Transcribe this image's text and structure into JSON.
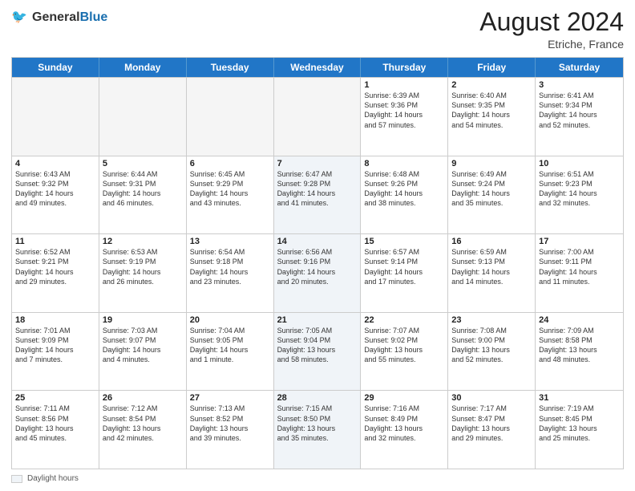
{
  "header": {
    "logo_general": "General",
    "logo_blue": "Blue",
    "month_year": "August 2024",
    "location": "Etriche, France"
  },
  "days_of_week": [
    "Sunday",
    "Monday",
    "Tuesday",
    "Wednesday",
    "Thursday",
    "Friday",
    "Saturday"
  ],
  "legend": {
    "label": "Daylight hours"
  },
  "weeks": [
    {
      "cells": [
        {
          "day": "",
          "content": "",
          "empty": true
        },
        {
          "day": "",
          "content": "",
          "empty": true
        },
        {
          "day": "",
          "content": "",
          "empty": true
        },
        {
          "day": "",
          "content": "",
          "empty": true
        },
        {
          "day": "1",
          "content": "Sunrise: 6:39 AM\nSunset: 9:36 PM\nDaylight: 14 hours\nand 57 minutes.",
          "empty": false
        },
        {
          "day": "2",
          "content": "Sunrise: 6:40 AM\nSunset: 9:35 PM\nDaylight: 14 hours\nand 54 minutes.",
          "empty": false
        },
        {
          "day": "3",
          "content": "Sunrise: 6:41 AM\nSunset: 9:34 PM\nDaylight: 14 hours\nand 52 minutes.",
          "empty": false
        }
      ]
    },
    {
      "cells": [
        {
          "day": "4",
          "content": "Sunrise: 6:43 AM\nSunset: 9:32 PM\nDaylight: 14 hours\nand 49 minutes.",
          "empty": false
        },
        {
          "day": "5",
          "content": "Sunrise: 6:44 AM\nSunset: 9:31 PM\nDaylight: 14 hours\nand 46 minutes.",
          "empty": false
        },
        {
          "day": "6",
          "content": "Sunrise: 6:45 AM\nSunset: 9:29 PM\nDaylight: 14 hours\nand 43 minutes.",
          "empty": false
        },
        {
          "day": "7",
          "content": "Sunrise: 6:47 AM\nSunset: 9:28 PM\nDaylight: 14 hours\nand 41 minutes.",
          "empty": false
        },
        {
          "day": "8",
          "content": "Sunrise: 6:48 AM\nSunset: 9:26 PM\nDaylight: 14 hours\nand 38 minutes.",
          "empty": false
        },
        {
          "day": "9",
          "content": "Sunrise: 6:49 AM\nSunset: 9:24 PM\nDaylight: 14 hours\nand 35 minutes.",
          "empty": false
        },
        {
          "day": "10",
          "content": "Sunrise: 6:51 AM\nSunset: 9:23 PM\nDaylight: 14 hours\nand 32 minutes.",
          "empty": false
        }
      ]
    },
    {
      "cells": [
        {
          "day": "11",
          "content": "Sunrise: 6:52 AM\nSunset: 9:21 PM\nDaylight: 14 hours\nand 29 minutes.",
          "empty": false
        },
        {
          "day": "12",
          "content": "Sunrise: 6:53 AM\nSunset: 9:19 PM\nDaylight: 14 hours\nand 26 minutes.",
          "empty": false
        },
        {
          "day": "13",
          "content": "Sunrise: 6:54 AM\nSunset: 9:18 PM\nDaylight: 14 hours\nand 23 minutes.",
          "empty": false
        },
        {
          "day": "14",
          "content": "Sunrise: 6:56 AM\nSunset: 9:16 PM\nDaylight: 14 hours\nand 20 minutes.",
          "empty": false
        },
        {
          "day": "15",
          "content": "Sunrise: 6:57 AM\nSunset: 9:14 PM\nDaylight: 14 hours\nand 17 minutes.",
          "empty": false
        },
        {
          "day": "16",
          "content": "Sunrise: 6:59 AM\nSunset: 9:13 PM\nDaylight: 14 hours\nand 14 minutes.",
          "empty": false
        },
        {
          "day": "17",
          "content": "Sunrise: 7:00 AM\nSunset: 9:11 PM\nDaylight: 14 hours\nand 11 minutes.",
          "empty": false
        }
      ]
    },
    {
      "cells": [
        {
          "day": "18",
          "content": "Sunrise: 7:01 AM\nSunset: 9:09 PM\nDaylight: 14 hours\nand 7 minutes.",
          "empty": false
        },
        {
          "day": "19",
          "content": "Sunrise: 7:03 AM\nSunset: 9:07 PM\nDaylight: 14 hours\nand 4 minutes.",
          "empty": false
        },
        {
          "day": "20",
          "content": "Sunrise: 7:04 AM\nSunset: 9:05 PM\nDaylight: 14 hours\nand 1 minute.",
          "empty": false
        },
        {
          "day": "21",
          "content": "Sunrise: 7:05 AM\nSunset: 9:04 PM\nDaylight: 13 hours\nand 58 minutes.",
          "empty": false
        },
        {
          "day": "22",
          "content": "Sunrise: 7:07 AM\nSunset: 9:02 PM\nDaylight: 13 hours\nand 55 minutes.",
          "empty": false
        },
        {
          "day": "23",
          "content": "Sunrise: 7:08 AM\nSunset: 9:00 PM\nDaylight: 13 hours\nand 52 minutes.",
          "empty": false
        },
        {
          "day": "24",
          "content": "Sunrise: 7:09 AM\nSunset: 8:58 PM\nDaylight: 13 hours\nand 48 minutes.",
          "empty": false
        }
      ]
    },
    {
      "cells": [
        {
          "day": "25",
          "content": "Sunrise: 7:11 AM\nSunset: 8:56 PM\nDaylight: 13 hours\nand 45 minutes.",
          "empty": false
        },
        {
          "day": "26",
          "content": "Sunrise: 7:12 AM\nSunset: 8:54 PM\nDaylight: 13 hours\nand 42 minutes.",
          "empty": false
        },
        {
          "day": "27",
          "content": "Sunrise: 7:13 AM\nSunset: 8:52 PM\nDaylight: 13 hours\nand 39 minutes.",
          "empty": false
        },
        {
          "day": "28",
          "content": "Sunrise: 7:15 AM\nSunset: 8:50 PM\nDaylight: 13 hours\nand 35 minutes.",
          "empty": false
        },
        {
          "day": "29",
          "content": "Sunrise: 7:16 AM\nSunset: 8:49 PM\nDaylight: 13 hours\nand 32 minutes.",
          "empty": false
        },
        {
          "day": "30",
          "content": "Sunrise: 7:17 AM\nSunset: 8:47 PM\nDaylight: 13 hours\nand 29 minutes.",
          "empty": false
        },
        {
          "day": "31",
          "content": "Sunrise: 7:19 AM\nSunset: 8:45 PM\nDaylight: 13 hours\nand 25 minutes.",
          "empty": false
        }
      ]
    }
  ]
}
